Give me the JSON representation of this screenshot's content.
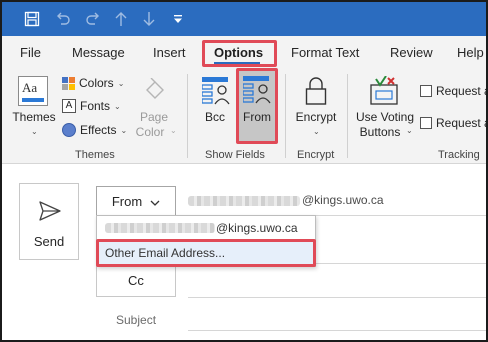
{
  "quick_access": {
    "icons": [
      "save-icon",
      "undo-icon",
      "redo-icon",
      "up-arrow-icon",
      "down-arrow-icon",
      "customize-qat-icon"
    ]
  },
  "ribbon_tabs": [
    "File",
    "Message",
    "Insert",
    "Options",
    "Format Text",
    "Review",
    "Help"
  ],
  "active_tab": "Options",
  "ribbon": {
    "themes_group": {
      "label": "Themes",
      "themes_button": "Themes",
      "colors": "Colors",
      "fonts": "Fonts",
      "effects": "Effects",
      "page_color_line1": "Page",
      "page_color_line2": "Color"
    },
    "show_fields_group": {
      "label": "Show Fields",
      "bcc": "Bcc",
      "from": "From"
    },
    "encrypt_group": {
      "label": "Encrypt",
      "encrypt": "Encrypt"
    },
    "tracking_group": {
      "label": "Tracking",
      "voting_line1": "Use Voting",
      "voting_line2": "Buttons",
      "request_1": "Request a",
      "request_2": "Request a"
    }
  },
  "compose": {
    "send": "Send",
    "from_button": "From",
    "from_address_domain": "@kings.uwo.ca",
    "cc_button": "Cc",
    "subject_label": "Subject"
  },
  "from_dropdown": {
    "account_domain": "@kings.uwo.ca",
    "other": "Other Email Address..."
  },
  "colors": {
    "titlebar": "#2b6cbf",
    "highlight": "#e04a57",
    "icon_blue": "#2b79d6"
  }
}
